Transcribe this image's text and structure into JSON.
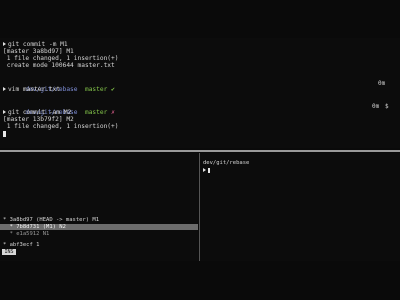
{
  "top_pane": {
    "lines": [
      "git commit -m M1",
      "[master 3a8bd97] M1",
      " 1 file changed, 1 insertion(+)",
      " create mode 100644 master.txt",
      "vim master.txt",
      "git commit -am M2",
      "[master 13b79f2] M2",
      " 1 file changed, 1 insertion(+)"
    ],
    "prompt1": {
      "path": "dev/git/rebase",
      "branch": "master",
      "mark": "✔",
      "time": "0m"
    },
    "prompt2": {
      "path": "dev/git/rebase",
      "branch": "master",
      "mark": "✗",
      "time": "0m"
    },
    "prompt_mark": "$"
  },
  "left_pane": {
    "head_line": "* 3a8bd97 (HEAD -> master) M1",
    "selected_line": "  * 7b8d731 (M1) N2",
    "next_line": "  * e1a5912 N1",
    "bottom_line": "* abf3ecf 1",
    "status_label": "INS"
  },
  "right_pane": {
    "path": "dev/git/rebase"
  },
  "colors": {
    "path": "#7f8fd8",
    "branch": "#83c44a",
    "dirty": "#d65b88"
  },
  "icons": {
    "prompt": "triangle-right-icon"
  }
}
